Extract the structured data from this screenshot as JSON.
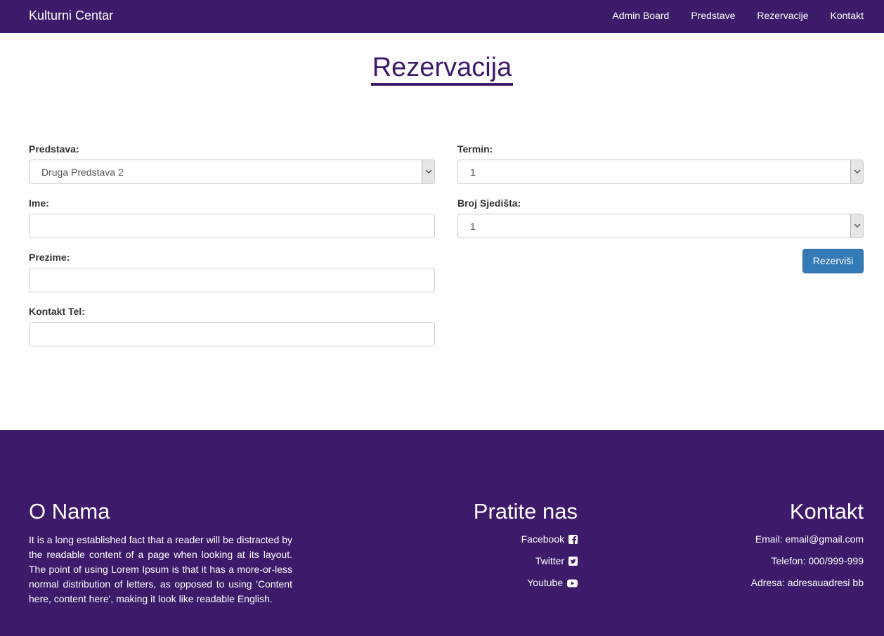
{
  "nav": {
    "brand": "Kulturni Centar",
    "links": [
      "Admin Board",
      "Predstave",
      "Rezervacije",
      "Kontakt"
    ]
  },
  "page": {
    "title": "Rezervacija"
  },
  "form": {
    "predstava": {
      "label": "Predstava:",
      "value": "Druga Predstava 2"
    },
    "ime": {
      "label": "Ime:",
      "value": ""
    },
    "prezime": {
      "label": "Prezime:",
      "value": ""
    },
    "kontakt_tel": {
      "label": "Kontakt Tel:",
      "value": ""
    },
    "termin": {
      "label": "Termin:",
      "value": "1"
    },
    "broj_sjedista": {
      "label": "Broj Sjedišta:",
      "value": "1"
    },
    "submit_label": "Rezerviši"
  },
  "footer": {
    "about": {
      "title": "O Nama",
      "text": "It is a long established fact that a reader will be distracted by the readable content of a page when looking at its layout. The point of using Lorem Ipsum is that it has a more-or-less normal distribution of letters, as opposed to using 'Content here, content here', making it look like readable English."
    },
    "social": {
      "title": "Pratite nas",
      "items": [
        {
          "label": "Facebook",
          "icon": "facebook-square-icon"
        },
        {
          "label": "Twitter",
          "icon": "twitter-square-icon"
        },
        {
          "label": "Youtube",
          "icon": "youtube-play-icon"
        }
      ]
    },
    "contact": {
      "title": "Kontakt",
      "email": "Email: email@gmail.com",
      "phone": "Telefon: 000/999-999",
      "address": "Adresa: adresauadresi bb"
    }
  },
  "colors": {
    "brand": "#3d1a6a",
    "primary_button": "#337ab7"
  }
}
